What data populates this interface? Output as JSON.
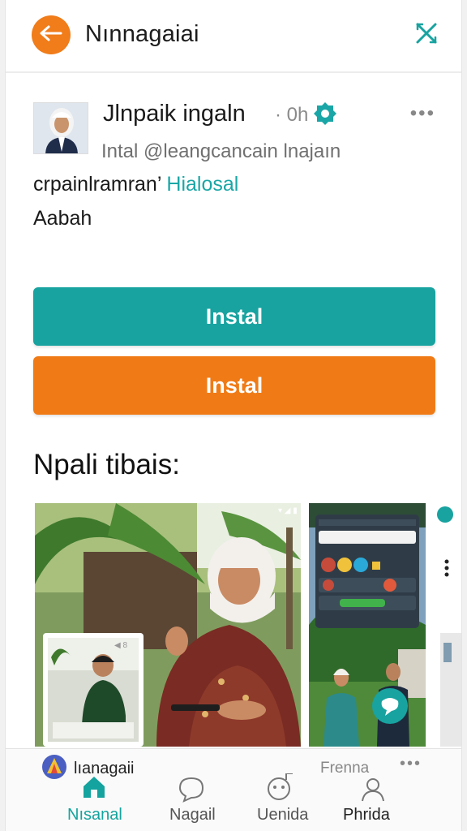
{
  "header": {
    "title": "Nınnagaiai",
    "back_icon": "back-arrow-icon",
    "close_icon": "close-icon",
    "accent": "#f07c1a"
  },
  "post": {
    "author_name": "Jlnpaik ingaln",
    "time": "· 0h",
    "verified_icon": "verified-badge-icon",
    "more_label": "•••",
    "handle_line": "Intal @leangcancain lnajaın",
    "body_text": "crpainlramran’",
    "body_link": "Hialosal",
    "body_line2": "Aabah"
  },
  "actions": {
    "primary_label": "Instal",
    "secondary_label": "Instal",
    "primary_color": "#18a3a0",
    "secondary_color": "#f07b16"
  },
  "section": {
    "title": "Npali tibais:"
  },
  "bottom_nav": {
    "app_chip_label": "lıanagaii",
    "items": [
      {
        "label": "Nısanal",
        "icon": "home-icon",
        "active": true
      },
      {
        "label": "Nagail",
        "icon": "chat-bubble-icon",
        "active": false
      },
      {
        "label": "Uenida",
        "icon": "face-icon",
        "active": false
      },
      {
        "label": "Phrida",
        "icon": "profile-icon",
        "active": false
      }
    ],
    "item4_top_label": "Frenna",
    "item4_more": "•••",
    "active_color": "#14a39e"
  }
}
